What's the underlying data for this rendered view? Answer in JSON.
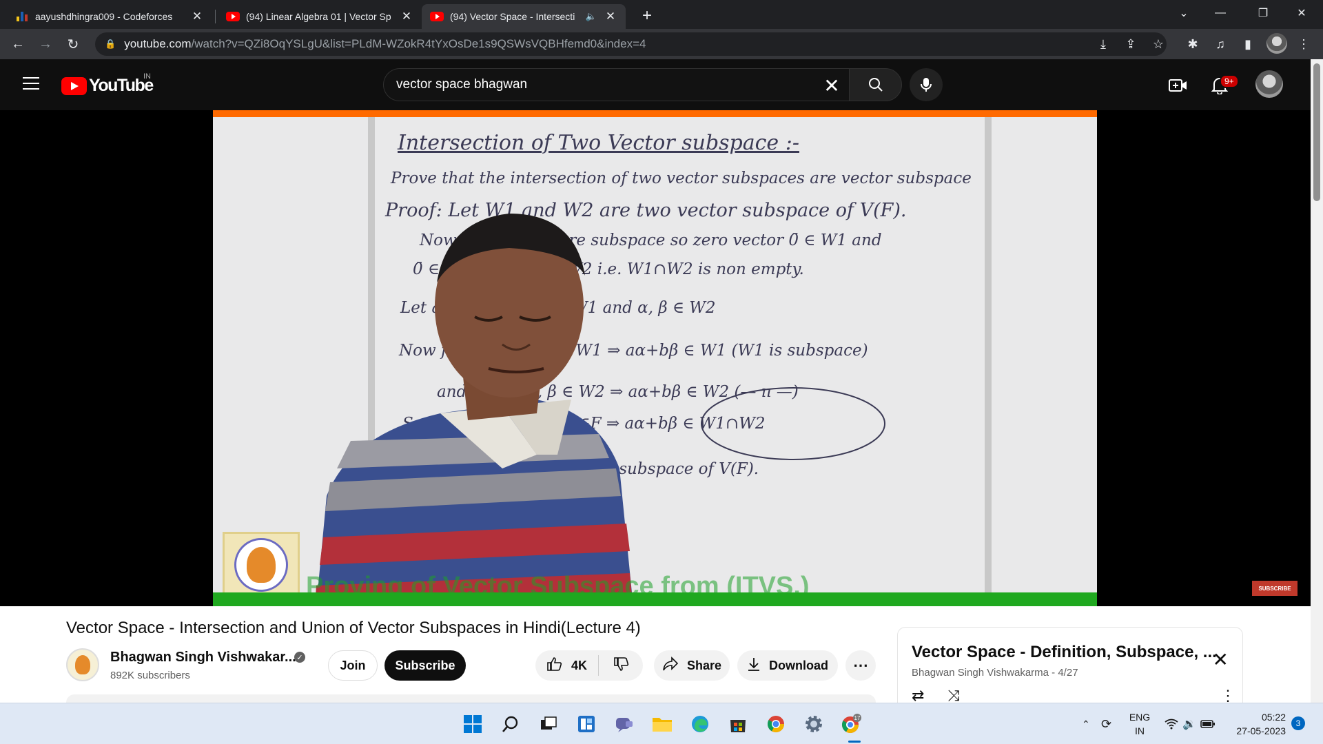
{
  "browser": {
    "tabs": [
      {
        "title": "aayushdhingra009 - Codeforces",
        "favicon": "codeforces-icon"
      },
      {
        "title": "(94) Linear Algebra 01 | Vector Sp",
        "favicon": "youtube-icon"
      },
      {
        "title": "(94) Vector Space - Intersecti",
        "favicon": "youtube-icon",
        "audio": "speaker-icon"
      }
    ],
    "new_tab": "+",
    "url_host": "youtube.com",
    "url_rest": "/watch?v=QZi8OqYSLgU&list=PLdM-WZokR4tYxOsDe1s9QSWsVQBHfemd0&index=4"
  },
  "youtube": {
    "logo_text": "YouTube",
    "country": "IN",
    "search_value": "vector space bhagwan",
    "notification_count": "9+"
  },
  "video": {
    "board_lines": [
      "Intersection of Two Vector subspace :-",
      "Prove that the intersection of two vector subspaces are vector subspace",
      "Proof: Let W1 and W2 are two vector subspace of V(F).",
      "Now W1 and W2 are subspace so zero vector 0̄ ∈ W1 and",
      "0̄ ∈ W2 ⇒ 0̄ ∈ W1∩W2   i.e. W1∩W2 is non empty.",
      "Let any α ... ⇒ α, β ∈ W1 and α, β ∈ W2",
      "Now for ... and α, β ∈ W1 ⇒ aα+bβ ∈ W1 (W1 is subspace)",
      "and ... and α, β ∈ W2 ⇒ aα+bβ ∈ W2 (— ıı —)",
      "So ... W1∩W2 and a,b∈F ⇒ aα+bβ ∈ W1∩W2",
      "... subspace of V(F)."
    ],
    "watermark": "Proving of Vector Subspace from (ITVS.)",
    "subscribe_badge": "SUBSCRIBE",
    "title": "Vector Space - Intersection and Union of Vector Subspaces in Hindi(Lecture 4)",
    "channel_name": "Bhagwan Singh Vishwakar...",
    "subscribers": "892K subscribers",
    "join_label": "Join",
    "subscribe_label": "Subscribe",
    "likes": "4K",
    "share_label": "Share",
    "download_label": "Download"
  },
  "playlist": {
    "title": "Vector Space - Definition, Subspace, ...",
    "subtitle": "Bhagwan Singh Vishwakarma - 4/27"
  },
  "taskbar": {
    "lang_top": "ENG",
    "lang_bottom": "IN",
    "time": "05:22",
    "date": "27-05-2023",
    "notif_count": "3",
    "chrome_badge": "17"
  },
  "colors": {
    "yt_red": "#ff0000",
    "header_bg": "#0f0f0f",
    "board_bg": "#e9e9ea",
    "orange_band": "#ff6a00",
    "green_band": "#1fa81f"
  }
}
